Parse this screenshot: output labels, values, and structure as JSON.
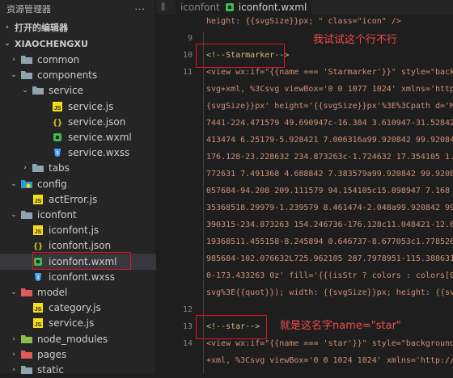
{
  "explorer": {
    "title": "资源管理器",
    "more": "···",
    "open_editors": "打开的编辑器",
    "project": "XIAOCHENGXU",
    "items": [
      {
        "label": "common",
        "chev": "›",
        "icon": "folder"
      },
      {
        "label": "components",
        "chev": "⌄",
        "icon": "folder"
      },
      {
        "label": "service",
        "chev": "⌄",
        "icon": "folder"
      },
      {
        "label": "service.js",
        "chev": "",
        "icon": "js"
      },
      {
        "label": "service.json",
        "chev": "",
        "icon": "json"
      },
      {
        "label": "service.wxml",
        "chev": "",
        "icon": "wxml"
      },
      {
        "label": "service.wxss",
        "chev": "",
        "icon": "wxss"
      },
      {
        "label": "tabs",
        "chev": "›",
        "icon": "folder"
      },
      {
        "label": "config",
        "chev": "⌄",
        "icon": "folder-config"
      },
      {
        "label": "actError.js",
        "chev": "",
        "icon": "js"
      },
      {
        "label": "iconfont",
        "chev": "⌄",
        "icon": "folder"
      },
      {
        "label": "iconfont.js",
        "chev": "",
        "icon": "js"
      },
      {
        "label": "iconfont.json",
        "chev": "",
        "icon": "json"
      },
      {
        "label": "iconfont.wxml",
        "chev": "",
        "icon": "wxml"
      },
      {
        "label": "iconfont.wxss",
        "chev": "",
        "icon": "wxss"
      },
      {
        "label": "model",
        "chev": "⌄",
        "icon": "folder-model"
      },
      {
        "label": "category.js",
        "chev": "",
        "icon": "js"
      },
      {
        "label": "service.js",
        "chev": "",
        "icon": "js"
      },
      {
        "label": "node_modules",
        "chev": "›",
        "icon": "folder-node"
      },
      {
        "label": "pages",
        "chev": "›",
        "icon": "folder-pages"
      },
      {
        "label": "static",
        "chev": "›",
        "icon": "folder"
      }
    ]
  },
  "editor": {
    "tab_label": "iconfont.wxml",
    "tab_prefix": "iconfont",
    "lines": [
      {
        "num": "",
        "text": "height: {{svgSize}}px; \" class=\"icon\" />",
        "kind": "str"
      },
      {
        "num": "9",
        "text": "",
        "kind": "str"
      },
      {
        "num": "10",
        "text": "<!--Starmarker-->",
        "kind": "comment"
      },
      {
        "num": "11",
        "text": "<view wx:if=\"{{name === 'Starmarker'}}\" style=\"backgr",
        "kind": "str"
      },
      {
        "num": "",
        "text": "svg+xml, %3Csvg viewBox='0 0 1077 1024' xmlns='http:/",
        "kind": "str"
      },
      {
        "num": "",
        "text": "{svgSize}}px' height='{{svgSize}}px'%3E%3Cpath d='M43",
        "kind": "str"
      },
      {
        "num": "",
        "text": "7441-224.471579 49.690947c-16.384 3.610947-31.528421",
        "kind": "str"
      },
      {
        "num": "",
        "text": "413474 6.25179-5.928421 7.006316a99.920842 99.920842",
        "kind": "str"
      },
      {
        "num": "",
        "text": "176.128-23.228632 234.873263c-1.724632 17.354105 1.13",
        "kind": "str"
      },
      {
        "num": "",
        "text": "772631 7.491368 4.688842 7.383579a99.920842 99.92084",
        "kind": "str"
      },
      {
        "num": "",
        "text": "057684-94.208 209.111579 94.154105c15.898947 7.168 33",
        "kind": "str"
      },
      {
        "num": "",
        "text": "35368518.29979-1.239579 8.461474-2.048a99.920842 99.9",
        "kind": "str"
      },
      {
        "num": "",
        "text": "390315-234.873263 154.246736-176.128c11.048421-12.61",
        "kind": "str"
      },
      {
        "num": "",
        "text": "19368511.455158-8.245894 0.646737-8.677053c1.778526-4",
        "kind": "str"
      },
      {
        "num": "",
        "text": "985684-102.076632L725.962105 287.7978951-115.388631-2",
        "kind": "str"
      },
      {
        "num": "",
        "text": "0-173.433263 0z' fill='{{(isStr ? colors : colors[0])",
        "kind": "str"
      },
      {
        "num": "",
        "text": "svg%3E{{quot}}); width: {{svgSize}}px; height: {{svgS",
        "kind": "str"
      },
      {
        "num": "12",
        "text": "",
        "kind": "str"
      },
      {
        "num": "13",
        "text": "<!--star-->",
        "kind": "comment"
      },
      {
        "num": "14",
        "text": "<view wx:if=\"{{name === 'star'}}\" style=\"background-i",
        "kind": "str"
      },
      {
        "num": "",
        "text": "+xml, %3Csvg viewBox='0 0 1024 1024' xmlns='http://www",
        "kind": "str"
      }
    ]
  },
  "annotations": {
    "note1": "我试试这个行不行",
    "note2": "就是这名字name=\"star\""
  },
  "colors": {
    "annotation": "#f14c4c",
    "highlight_box": "#e81123",
    "js_icon": "#f5de19",
    "json_icon": "#f5de19",
    "wxml_icon": "#3fb950",
    "wxss_icon": "#42a5f5",
    "folder": "#90a4ae"
  }
}
